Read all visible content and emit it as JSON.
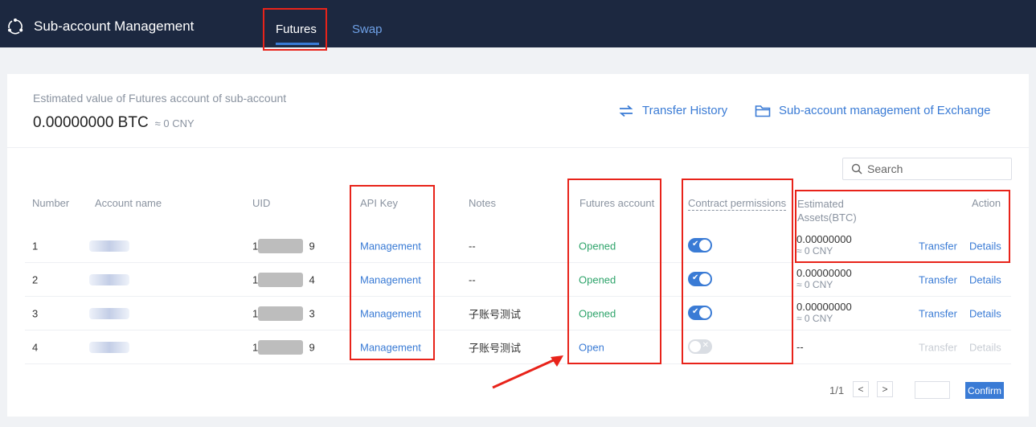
{
  "header": {
    "title": "Sub-account Management",
    "tabs": [
      {
        "label": "Futures",
        "active": true
      },
      {
        "label": "Swap",
        "active": false
      }
    ]
  },
  "summary": {
    "label": "Estimated value of Futures account of sub-account",
    "value": "0.00000000 BTC",
    "approx": "≈  0 CNY",
    "transfer_history": "Transfer History",
    "exchange_link": "Sub-account management of Exchange"
  },
  "search": {
    "placeholder": "Search"
  },
  "table": {
    "headers": {
      "number": "Number",
      "account_name": "Account name",
      "uid": "UID",
      "api_key": "API Key",
      "notes": "Notes",
      "futures_account": "Futures account",
      "contract_permissions": "Contract permissions",
      "estimated_1": "Estimated",
      "estimated_2": "Assets(BTC)",
      "action": "Action"
    },
    "rows": [
      {
        "number": "1",
        "uid_start": "1",
        "uid_end": "9",
        "api": "Management",
        "notes": "--",
        "futures": "Opened",
        "permission": true,
        "assets": "0.00000000",
        "assets_cny": "≈ 0 CNY",
        "transfer": "Transfer",
        "details": "Details"
      },
      {
        "number": "2",
        "uid_start": "1",
        "uid_end": "4",
        "api": "Management",
        "notes": "--",
        "futures": "Opened",
        "permission": true,
        "assets": "0.00000000",
        "assets_cny": "≈ 0 CNY",
        "transfer": "Transfer",
        "details": "Details"
      },
      {
        "number": "3",
        "uid_start": "1",
        "uid_end": "3",
        "api": "Management",
        "notes": "子账号测试",
        "futures": "Opened",
        "permission": true,
        "assets": "0.00000000",
        "assets_cny": "≈ 0 CNY",
        "transfer": "Transfer",
        "details": "Details"
      },
      {
        "number": "4",
        "uid_start": "1",
        "uid_end": "9",
        "api": "Management",
        "notes": "子账号测试",
        "futures": "Open",
        "permission": false,
        "assets": "--",
        "assets_cny": "",
        "transfer": "Transfer",
        "details": "Details"
      }
    ]
  },
  "pagination": {
    "page_info": "1/1",
    "prev": "<",
    "next": ">",
    "confirm": "Confirm"
  },
  "colors": {
    "topbar": "#1c2840",
    "accent": "#3a7bd5",
    "opened": "#2fa46b",
    "annotation_red": "#e8231a"
  },
  "icons": {
    "brand": "orbit-icon",
    "transfer_history": "transfer-arrows-icon",
    "exchange": "folder-icon",
    "search": "search-icon",
    "toggle_on": "check-icon",
    "toggle_off": "x-icon"
  }
}
